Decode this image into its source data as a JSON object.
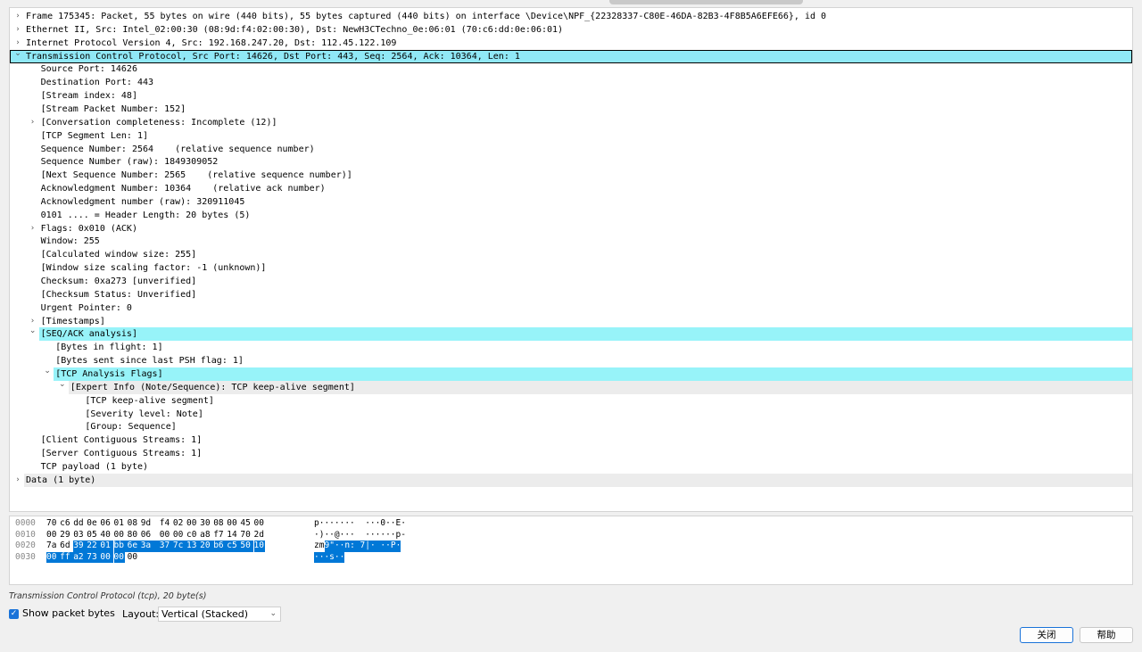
{
  "tree": [
    {
      "depth": 0,
      "arrow": "right",
      "text": "Frame 175345: Packet, 55 bytes on wire (440 bits), 55 bytes captured (440 bits) on interface \\Device\\NPF_{22328337-C80E-46DA-82B3-4F8B5A6EFE66}, id 0"
    },
    {
      "depth": 0,
      "arrow": "right",
      "text": "Ethernet II, Src: Intel_02:00:30 (08:9d:f4:02:00:30), Dst: NewH3CTechno_0e:06:01 (70:c6:dd:0e:06:01)"
    },
    {
      "depth": 0,
      "arrow": "right",
      "text": "Internet Protocol Version 4, Src: 192.168.247.20, Dst: 112.45.122.109"
    },
    {
      "depth": 0,
      "arrow": "down",
      "style": "sel",
      "text": "Transmission Control Protocol, Src Port: 14626, Dst Port: 443, Seq: 2564, Ack: 10364, Len: 1"
    },
    {
      "depth": 1,
      "text": "Source Port: 14626"
    },
    {
      "depth": 1,
      "text": "Destination Port: 443"
    },
    {
      "depth": 1,
      "text": "[Stream index: 48]"
    },
    {
      "depth": 1,
      "text": "[Stream Packet Number: 152]"
    },
    {
      "depth": 1,
      "arrow": "right",
      "text": "[Conversation completeness: Incomplete (12)]"
    },
    {
      "depth": 1,
      "text": "[TCP Segment Len: 1]"
    },
    {
      "depth": 1,
      "text": "Sequence Number: 2564    (relative sequence number)"
    },
    {
      "depth": 1,
      "text": "Sequence Number (raw): 1849309052"
    },
    {
      "depth": 1,
      "text": "[Next Sequence Number: 2565    (relative sequence number)]"
    },
    {
      "depth": 1,
      "text": "Acknowledgment Number: 10364    (relative ack number)"
    },
    {
      "depth": 1,
      "text": "Acknowledgment number (raw): 320911045"
    },
    {
      "depth": 1,
      "text": "0101 .... = Header Length: 20 bytes (5)"
    },
    {
      "depth": 1,
      "arrow": "right",
      "text": "Flags: 0x010 (ACK)"
    },
    {
      "depth": 1,
      "text": "Window: 255"
    },
    {
      "depth": 1,
      "text": "[Calculated window size: 255]"
    },
    {
      "depth": 1,
      "text": "[Window size scaling factor: -1 (unknown)]"
    },
    {
      "depth": 1,
      "text": "Checksum: 0xa273 [unverified]"
    },
    {
      "depth": 1,
      "text": "[Checksum Status: Unverified]"
    },
    {
      "depth": 1,
      "text": "Urgent Pointer: 0"
    },
    {
      "depth": 1,
      "arrow": "right",
      "text": "[Timestamps]"
    },
    {
      "depth": 1,
      "arrow": "down",
      "style": "hl",
      "text": "[SEQ/ACK analysis]"
    },
    {
      "depth": 2,
      "text": "[Bytes in flight: 1]"
    },
    {
      "depth": 2,
      "text": "[Bytes sent since last PSH flag: 1]"
    },
    {
      "depth": 2,
      "arrow": "down",
      "style": "hl",
      "text": "[TCP Analysis Flags]"
    },
    {
      "depth": 3,
      "arrow": "down",
      "style": "alt",
      "text": "[Expert Info (Note/Sequence): TCP keep-alive segment]"
    },
    {
      "depth": 4,
      "text": "[TCP keep-alive segment]"
    },
    {
      "depth": 4,
      "text": "[Severity level: Note]"
    },
    {
      "depth": 4,
      "text": "[Group: Sequence]"
    },
    {
      "depth": 1,
      "text": "[Client Contiguous Streams: 1]"
    },
    {
      "depth": 1,
      "text": "[Server Contiguous Streams: 1]"
    },
    {
      "depth": 1,
      "text": "TCP payload (1 byte)"
    },
    {
      "depth": 0,
      "arrow": "right",
      "style": "alt",
      "text": "Data (1 byte)"
    }
  ],
  "hex": [
    {
      "offset": "0000",
      "bytes": [
        "70",
        "c6",
        "dd",
        "0e",
        "06",
        "01",
        "08",
        "9d",
        "f4",
        "02",
        "00",
        "30",
        "08",
        "00",
        "45",
        "00"
      ],
      "ascii": "p·······  ···0··E·",
      "sel_from": 16,
      "sel_to": 16
    },
    {
      "offset": "0010",
      "bytes": [
        "00",
        "29",
        "03",
        "05",
        "40",
        "00",
        "80",
        "06",
        "00",
        "00",
        "c0",
        "a8",
        "f7",
        "14",
        "70",
        "2d"
      ],
      "ascii": "·)··@···  ······p-",
      "sel_from": 16,
      "sel_to": 16
    },
    {
      "offset": "0020",
      "bytes": [
        "7a",
        "6d",
        "39",
        "22",
        "01",
        "bb",
        "6e",
        "3a",
        "37",
        "7c",
        "13",
        "20",
        "b6",
        "c5",
        "50",
        "10"
      ],
      "ascii_plain": "zm",
      "ascii_sel": "9\"··n: 7|· ··P·",
      "sel_from": 2,
      "sel_to": 16
    },
    {
      "offset": "0030",
      "bytes": [
        "00",
        "ff",
        "a2",
        "73",
        "00",
        "00",
        "00"
      ],
      "ascii_plain": "",
      "ascii_sel": "···s··",
      "sel_from": 0,
      "sel_to": 6
    }
  ],
  "status_text": "Transmission Control Protocol (tcp), 20 byte(s)",
  "show_bytes_label": "Show packet bytes",
  "show_bytes_checked": true,
  "layout_label": "Layout:",
  "layout_value": "Vertical (Stacked)",
  "close_label": "关闭",
  "help_label": "帮助",
  "colors": {
    "highlight": "#97f3f9",
    "selection": "#0078d7",
    "accent": "#1a73d9"
  }
}
